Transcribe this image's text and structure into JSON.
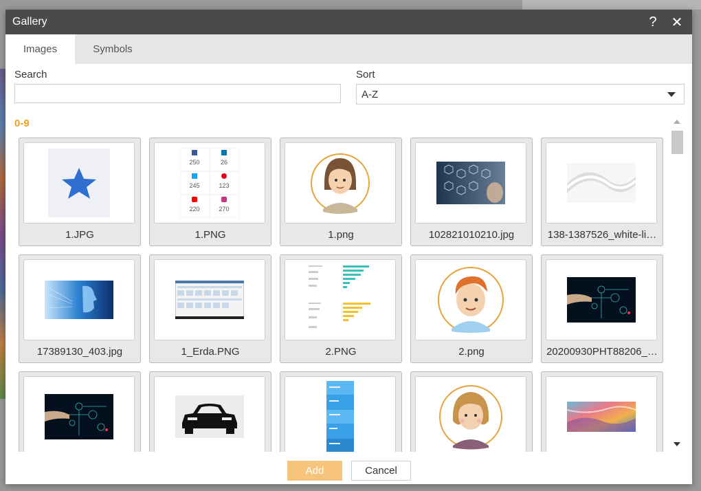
{
  "dialog": {
    "title": "Gallery",
    "help_glyph": "?",
    "close_glyph": "✕"
  },
  "tabs": [
    {
      "label": "Images",
      "active": true
    },
    {
      "label": "Symbols",
      "active": false
    }
  ],
  "search": {
    "label": "Search",
    "value": "",
    "placeholder": ""
  },
  "sort": {
    "label": "Sort",
    "value": "A-Z"
  },
  "group": {
    "heading": "0-9"
  },
  "images": [
    {
      "filename": "1.JPG",
      "thumb": "blue-star-image"
    },
    {
      "filename": "1.PNG",
      "thumb": "social-stats-image"
    },
    {
      "filename": "1.png",
      "thumb": "girl-avatar-image"
    },
    {
      "filename": "102821010210.jpg",
      "thumb": "tech-icons-photo"
    },
    {
      "filename": "138-1387526_white-li…",
      "thumb": "white-line-image"
    },
    {
      "filename": "17389130_403.jpg",
      "thumb": "digital-face-photo"
    },
    {
      "filename": "1_Erda.PNG",
      "thumb": "dashboard-screenshot"
    },
    {
      "filename": "2.PNG",
      "thumb": "bar-chart-image"
    },
    {
      "filename": "2.png",
      "thumb": "boy-avatar-image"
    },
    {
      "filename": "20200930PHT88206_…",
      "thumb": "circuit-hand-photo"
    },
    {
      "filename": "",
      "thumb": "circuit-hand-photo"
    },
    {
      "filename": "",
      "thumb": "car-icon-image"
    },
    {
      "filename": "",
      "thumb": "infographic-image"
    },
    {
      "filename": "",
      "thumb": "woman-avatar-image"
    },
    {
      "filename": "",
      "thumb": "colorful-landscape-image"
    }
  ],
  "social_stats": [
    "250",
    "26",
    "245",
    "123",
    "220",
    "270"
  ],
  "footer": {
    "add_label": "Add",
    "cancel_label": "Cancel"
  },
  "colors": {
    "accent": "#f0a020",
    "add_button": "#f6c47c",
    "titlebar": "#4a4a4a"
  }
}
